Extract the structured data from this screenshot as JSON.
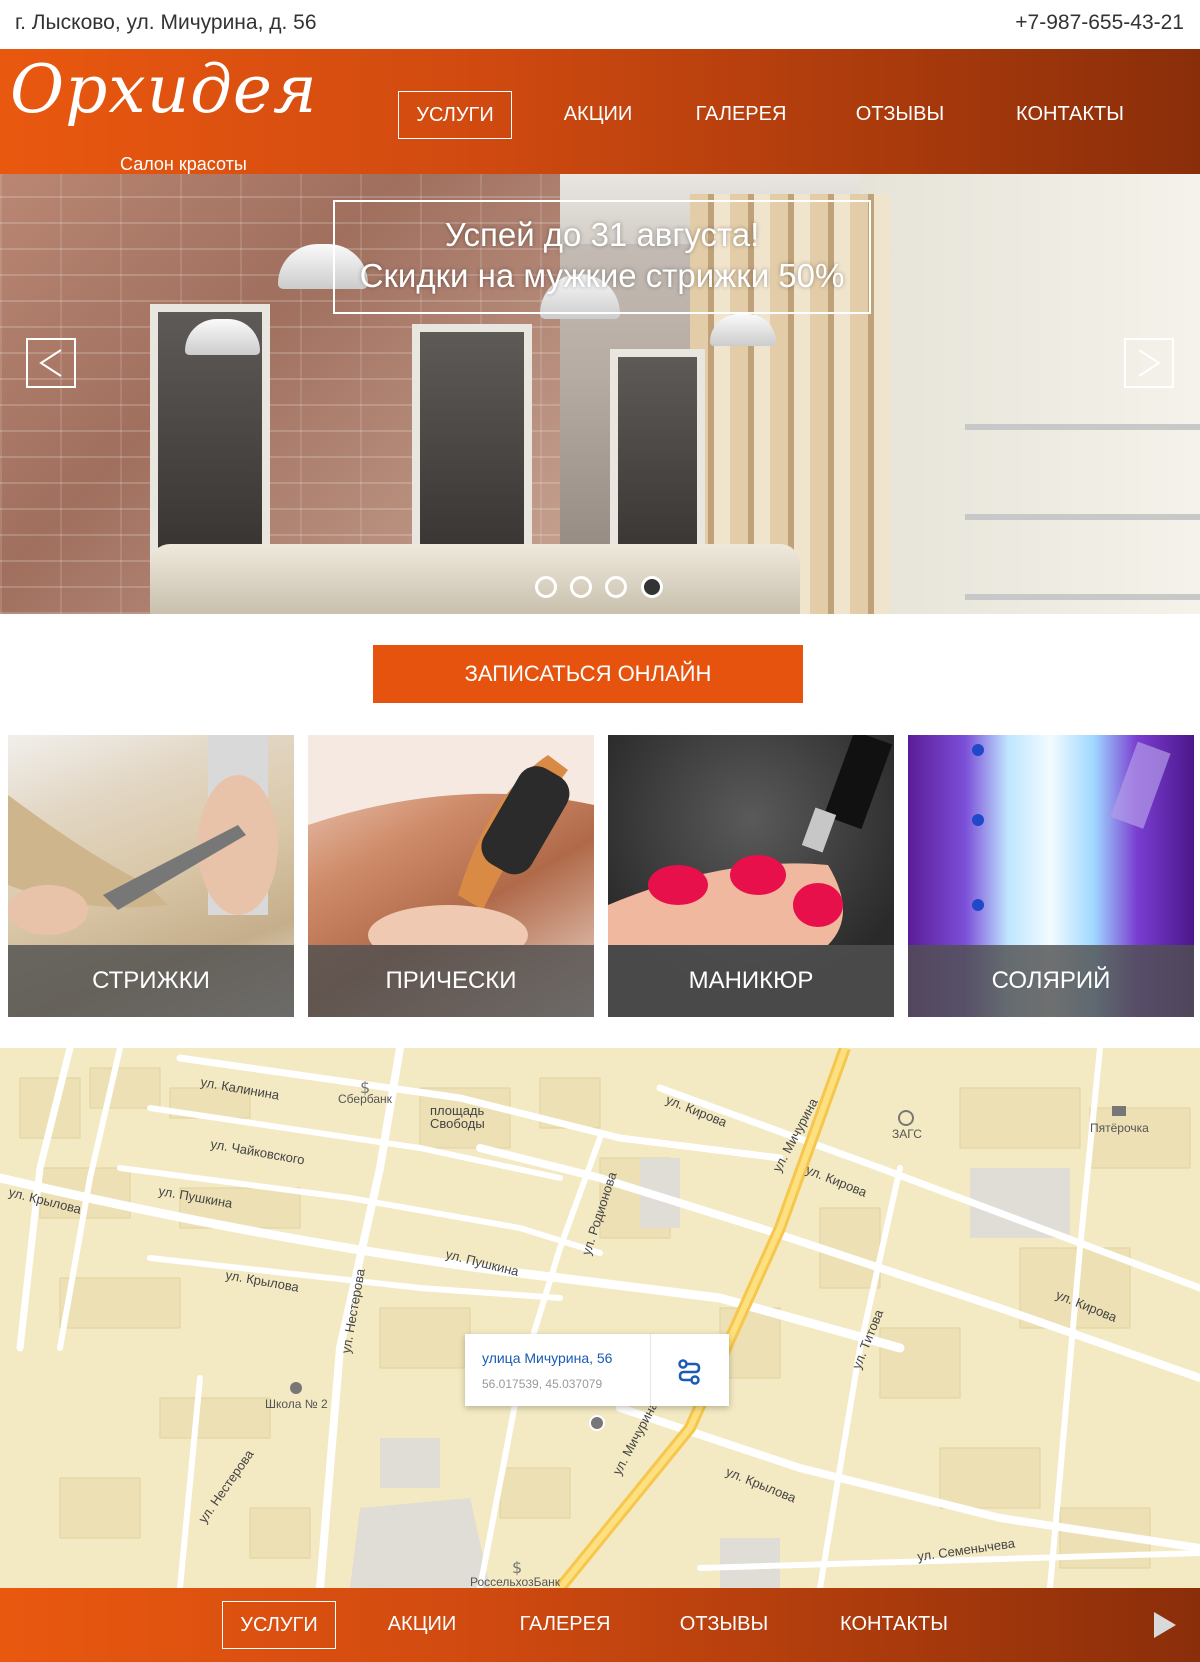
{
  "topbar": {
    "address": "г. Лысково, ул. Мичурина, д. 56",
    "phone": "+7-987-655-43-21"
  },
  "brand": {
    "name": "Орхидея",
    "tagline": "Салон красоты"
  },
  "nav": {
    "items": [
      "УСЛУГИ",
      "АКЦИИ",
      "ГАЛЕРЕЯ",
      "ОТЗЫВЫ",
      "КОНТАКТЫ"
    ],
    "active": "УСЛУГИ"
  },
  "hero": {
    "promo_line1": "Успей до 31 августа!",
    "promo_line2": "Скидки на мужкие стрижки 50%",
    "slides_count": 4
  },
  "cta": {
    "label": "ЗАПИСАТЬСЯ ОНЛАЙН"
  },
  "services": [
    {
      "label": "СТРИЖКИ"
    },
    {
      "label": "ПРИЧЕСКИ"
    },
    {
      "label": "МАНИКЮР"
    },
    {
      "label": "СОЛЯРИЙ"
    }
  ],
  "map": {
    "popup_title": "улица Мичурина, 56",
    "popup_coords": "56.017539, 45.037079",
    "labels": {
      "kalinina": "ул. Калинина",
      "sberbank": "Сбербанк",
      "square": "площадь",
      "square2": "Свободы",
      "chaikovskogo": "ул. Чайковского",
      "pushkina1": "ул. Пушкина",
      "krylova1": "ул. Крылова",
      "pushkina2": "ул. Пушкина",
      "krylova2": "ул. Крылова",
      "nesterova1": "ул. Нестерова",
      "rodionova": "ул. Родионова",
      "kirova1": "ул. Кирова",
      "michurina1": "ул. Мичурина",
      "kirova2": "ул. Кирова",
      "zags": "ЗАГС",
      "pyaterochka": "Пятёрочка",
      "kirova3": "ул. Кирова",
      "titova": "ул. Титова",
      "school": "Школа № 2",
      "nesterova2": "ул. Нестерова",
      "michurina2": "ул. Мичурина",
      "krylova3": "ул. Крылова",
      "semenycheva": "ул. Семенычева",
      "rosselhoz": "РоссельхозБанк"
    }
  },
  "footer": {
    "items": [
      "УСЛУГИ",
      "АКЦИИ",
      "ГАЛЕРЕЯ",
      "ОТЗЫВЫ",
      "КОНТАКТЫ"
    ],
    "active": "УСЛУГИ"
  },
  "colors": {
    "accent": "#e5530f",
    "header_dark": "#8a2e0a",
    "map_bg": "#f3e9c2"
  }
}
